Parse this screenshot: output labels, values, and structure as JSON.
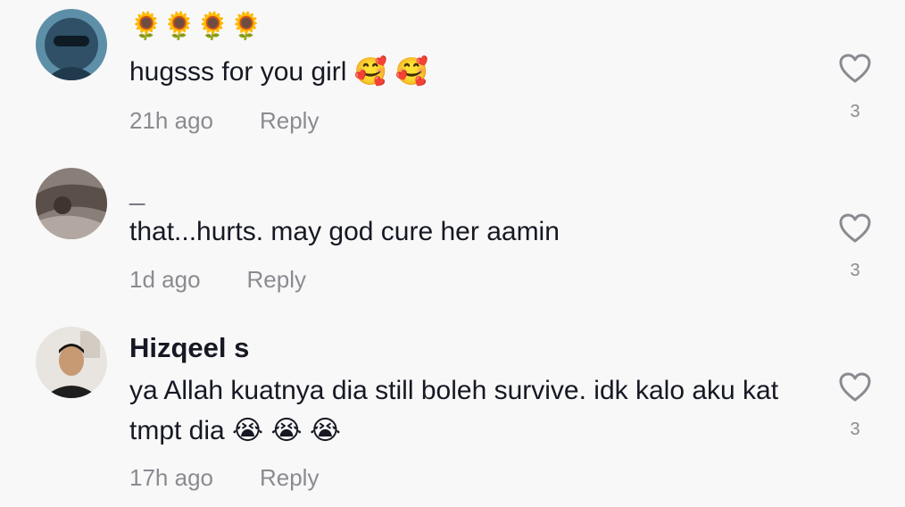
{
  "comments": [
    {
      "username": "🌻🌻🌻🌻",
      "text": "hugsss for you girl 🥰 🥰",
      "time": "21h ago",
      "reply": "Reply",
      "likes": "3",
      "like_icon": "heart-outline-icon"
    },
    {
      "username": "_",
      "text": "that...hurts. may god cure her aamin",
      "time": "1d ago",
      "reply": "Reply",
      "likes": "3",
      "like_icon": "heart-outline-icon"
    },
    {
      "username": "Hizqeel s",
      "text": "ya Allah kuatnya dia still boleh survive. idk kalo aku kat tmpt dia 😭 😭 😭",
      "time": "17h ago",
      "reply": "Reply",
      "likes": "3",
      "like_icon": "heart-outline-icon"
    }
  ]
}
